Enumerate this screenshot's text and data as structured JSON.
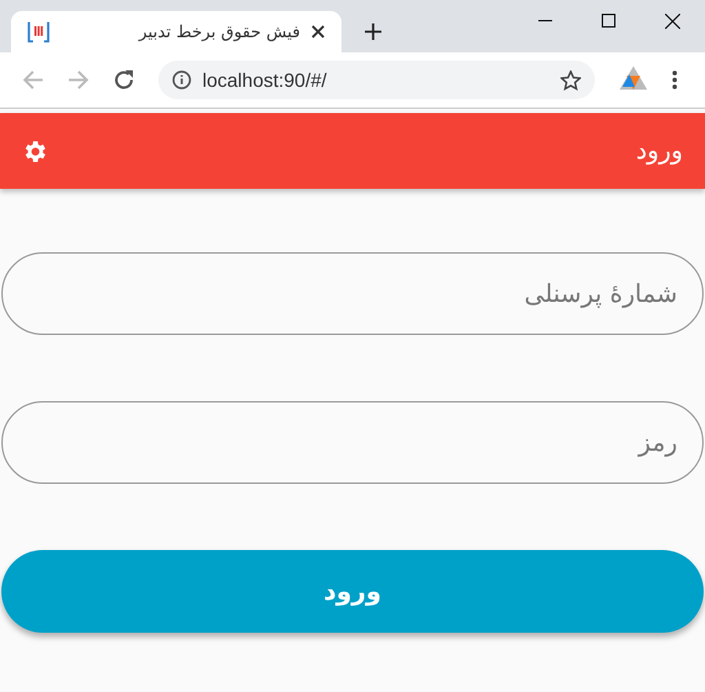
{
  "browser": {
    "tab_title": "فیش حقوق برخط تدبیر",
    "address": "localhost:90/#/"
  },
  "header": {
    "title": "ورود"
  },
  "form": {
    "fields": [
      {
        "placeholder": "شمارهٔ پرسنلی"
      },
      {
        "placeholder": "رمز"
      }
    ],
    "submit": "ورود"
  }
}
